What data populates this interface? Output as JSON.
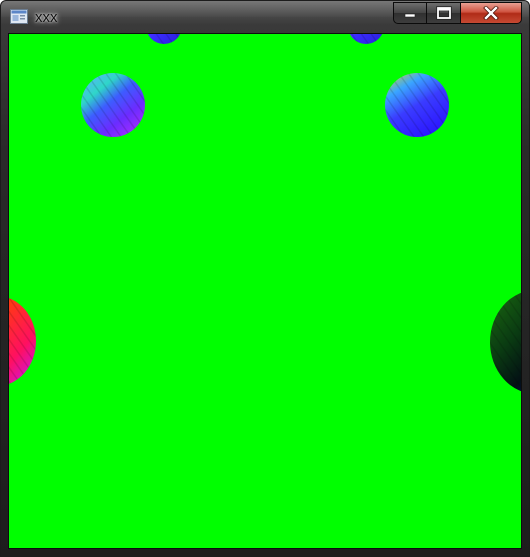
{
  "window": {
    "title": "xxx",
    "app_icon": "window-app-icon"
  },
  "controls": {
    "minimize_icon": "minimize-icon",
    "maximize_icon": "maximize-icon",
    "close_icon": "close-icon"
  },
  "canvas": {
    "background_color": "#00ff00",
    "objects": [
      {
        "name": "sphere-top-left-partial",
        "palette": "blue-magenta"
      },
      {
        "name": "sphere-top-right-partial",
        "palette": "blue-magenta"
      },
      {
        "name": "sphere-upper-left",
        "palette": "blue-magenta-cyan"
      },
      {
        "name": "sphere-upper-right",
        "palette": "blue-magenta-cyan"
      },
      {
        "name": "sphere-left-edge",
        "palette": "red-orange-magenta"
      },
      {
        "name": "sphere-right-edge",
        "palette": "dark-green-blue"
      }
    ]
  }
}
